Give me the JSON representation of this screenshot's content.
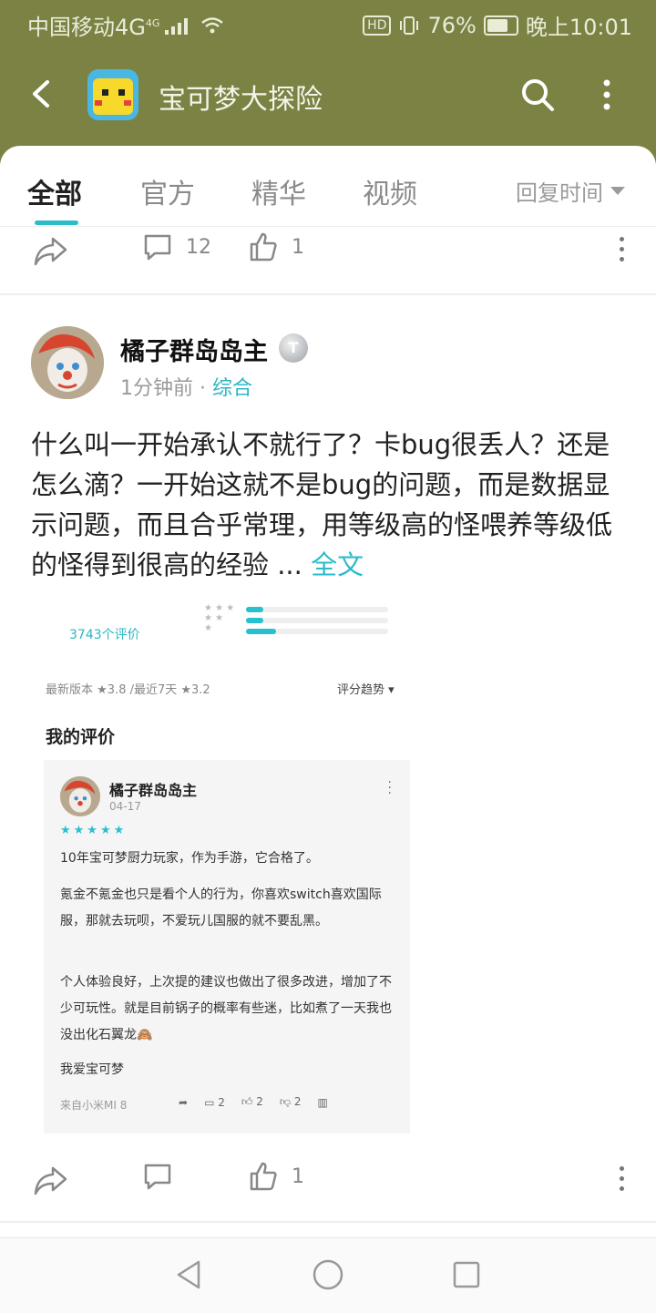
{
  "status_bar": {
    "carrier": "中国移动4G",
    "network_sup": "4G",
    "hd": "HD",
    "battery": "76%",
    "time": "晚上10:01"
  },
  "app_bar": {
    "title": "宝可梦大探险"
  },
  "tabs": {
    "items": [
      "全部",
      "官方",
      "精华",
      "视频"
    ],
    "active": "全部",
    "sort_label": "回复时间"
  },
  "prev_post_actions": {
    "comment_count": "12",
    "like_count": "1"
  },
  "post": {
    "author": "橘子群岛岛主",
    "badge": "T",
    "time": "1分钟前",
    "separator": "·",
    "category": "综合",
    "text": "什么叫一开始承认不就行了？卡bug很丢人？还是怎么滴？一开始这就不是bug的问题，而是数据显示问题，而且合乎常理，用等级高的怪喂养等级低的怪得到很高的经验 ...",
    "full_text_link": "全文",
    "like_count": "1"
  },
  "screenshot": {
    "rating_count": "3743个评价",
    "version_line": "最新版本 ★3.8 /最近7天 ★3.2",
    "trend_label": "评分趋势",
    "section_title": "我的评价",
    "bar_levels": [
      0.12,
      0.12,
      0.21
    ],
    "review": {
      "author": "橘子群岛岛主",
      "date": "04-17",
      "stars": "★★★★★",
      "p1": "10年宝可梦厨力玩家，作为手游，它合格了。",
      "p2": "氪金不氪金也只是看个人的行为，你喜欢switch喜欢国际服，那就去玩呗，不爱玩儿国服的就不要乱黑。",
      "p3": "个人体验良好，上次提的建议也做出了很多改进，增加了不少可玩性。就是目前锅子的概率有些迷，比如煮了一天我也没出化石翼龙🙈",
      "p4": "我爱宝可梦",
      "device": "来自小米MI 8",
      "comments": "2",
      "likes": "2",
      "dislikes": "2"
    }
  },
  "colors": {
    "header": "#7b8244",
    "accent": "#2cbcc9"
  }
}
